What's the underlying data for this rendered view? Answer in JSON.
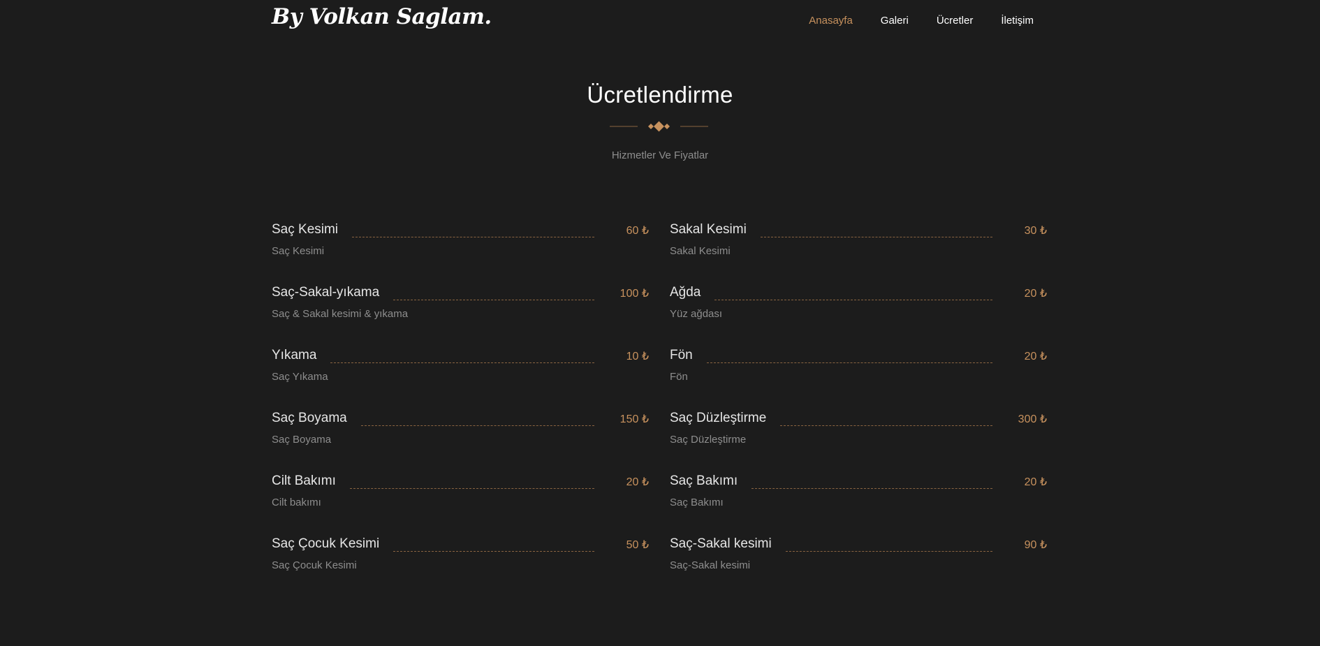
{
  "header": {
    "logo": "By Volkan Saglam.",
    "nav": [
      {
        "label": "Anasayfa",
        "active": true
      },
      {
        "label": "Galeri",
        "active": false
      },
      {
        "label": "Ücretler",
        "active": false
      },
      {
        "label": "İletişim",
        "active": false
      }
    ]
  },
  "section": {
    "title": "Ücretlendirme",
    "divider_icon": "diamond-ornament-icon",
    "subtitle": "Hizmetler Ve Fiyatlar"
  },
  "prices": {
    "left": [
      {
        "name": "Saç Kesimi",
        "price": "60 ₺",
        "desc": "Saç Kesimi"
      },
      {
        "name": "Saç-Sakal-yıkama",
        "price": "100 ₺",
        "desc": "Saç & Sakal kesimi & yıkama"
      },
      {
        "name": "Yıkama",
        "price": "10 ₺",
        "desc": "Saç Yıkama"
      },
      {
        "name": "Saç Boyama",
        "price": "150 ₺",
        "desc": "Saç Boyama"
      },
      {
        "name": "Cilt Bakımı",
        "price": "20 ₺",
        "desc": "Cilt bakımı"
      },
      {
        "name": "Saç Çocuk Kesimi",
        "price": "50 ₺",
        "desc": "Saç Çocuk Kesimi"
      }
    ],
    "right": [
      {
        "name": "Sakal Kesimi",
        "price": "30 ₺",
        "desc": "Sakal Kesimi"
      },
      {
        "name": "Ağda",
        "price": "20 ₺",
        "desc": "Yüz ağdası"
      },
      {
        "name": "Fön",
        "price": "20 ₺",
        "desc": "Fön"
      },
      {
        "name": "Saç Düzleştirme",
        "price": "300 ₺",
        "desc": "Saç Düzleştirme"
      },
      {
        "name": "Saç Bakımı",
        "price": "20 ₺",
        "desc": "Saç Bakımı"
      },
      {
        "name": "Saç-Sakal kesimi",
        "price": "90 ₺",
        "desc": "Saç-Sakal kesimi"
      }
    ]
  },
  "colors": {
    "background": "#1c1c1c",
    "accent": "#c8925e",
    "text": "#ffffff",
    "muted": "#8e8e8e"
  }
}
